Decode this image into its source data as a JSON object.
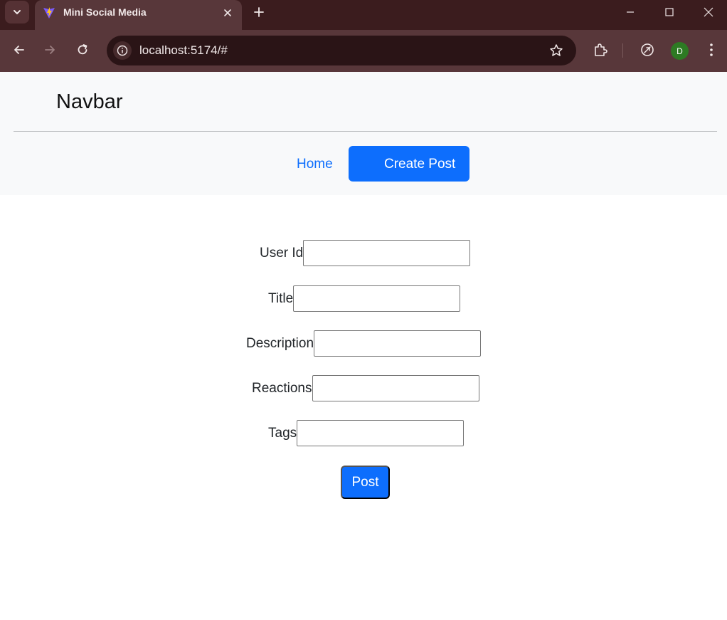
{
  "browser": {
    "tab_title": "Mini Social Media",
    "url": "localhost:5174/#",
    "profile_initial": "D"
  },
  "navbar": {
    "brand": "Navbar",
    "links": [
      {
        "label": "Home",
        "active": false
      },
      {
        "label": "Create Post",
        "active": true
      }
    ]
  },
  "form": {
    "fields": [
      {
        "label": "User Id",
        "value": ""
      },
      {
        "label": "Title",
        "value": ""
      },
      {
        "label": "Description",
        "value": ""
      },
      {
        "label": "Reactions",
        "value": ""
      },
      {
        "label": "Tags",
        "value": ""
      }
    ],
    "submit_label": "Post"
  },
  "colors": {
    "primary": "#0d6efd",
    "navbar_bg": "#f8f9fa",
    "chrome_bg": "#3b1c1e",
    "toolbar_bg": "#58373a"
  }
}
